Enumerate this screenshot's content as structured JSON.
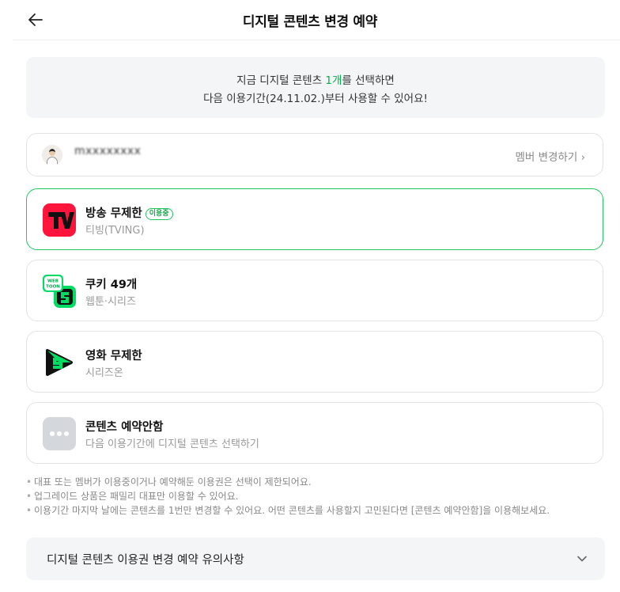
{
  "header": {
    "title": "디지털 콘텐츠 변경 예약"
  },
  "notice": {
    "line1_prefix": "지금 디지털 콘텐츠 ",
    "line1_count": "1개",
    "line1_suffix": "를 선택하면",
    "line2": "다음 이용기간(24.11.02.)부터 사용할 수 있어요!"
  },
  "member": {
    "name": "mxxxxxxxx",
    "change_label": "멤버 변경하기 ›"
  },
  "options": [
    {
      "title": "방송 무제한",
      "badge": "이용중",
      "subtitle": "티빙(TVING)",
      "icon": "tving-logo-icon"
    },
    {
      "title": "쿠키 49개",
      "subtitle": "웹툰·시리즈",
      "icon": "webtoon-logo-icon"
    },
    {
      "title": "영화 무제한",
      "subtitle": "시리즈온",
      "icon": "serieson-logo-icon"
    },
    {
      "title": "콘텐츠 예약안함",
      "subtitle": "다음 이용기간에 디지털 콘텐츠 선택하기",
      "icon": "more-dots-icon"
    }
  ],
  "notes": [
    "대표 또는 멤버가 이용중이거나 예약해둔 이용권은 선택이 제한되어요.",
    "업그레이드 상품은 패밀리 대표만 이용할 수 있어요.",
    "이용기간 마지막 날에는 콘텐츠를 1번만 변경할 수 있어요. 어떤 콘텐츠를 사용할지 고민된다면 [콘텐츠 예약안함]을 이용해보세요."
  ],
  "accordion": {
    "title": "디지털 콘텐츠 이용권 변경 예약 유의사항"
  },
  "colors": {
    "accent_green": "#00b34a",
    "tving_red": "#ff153c",
    "webtoon_green": "#00dc64"
  }
}
